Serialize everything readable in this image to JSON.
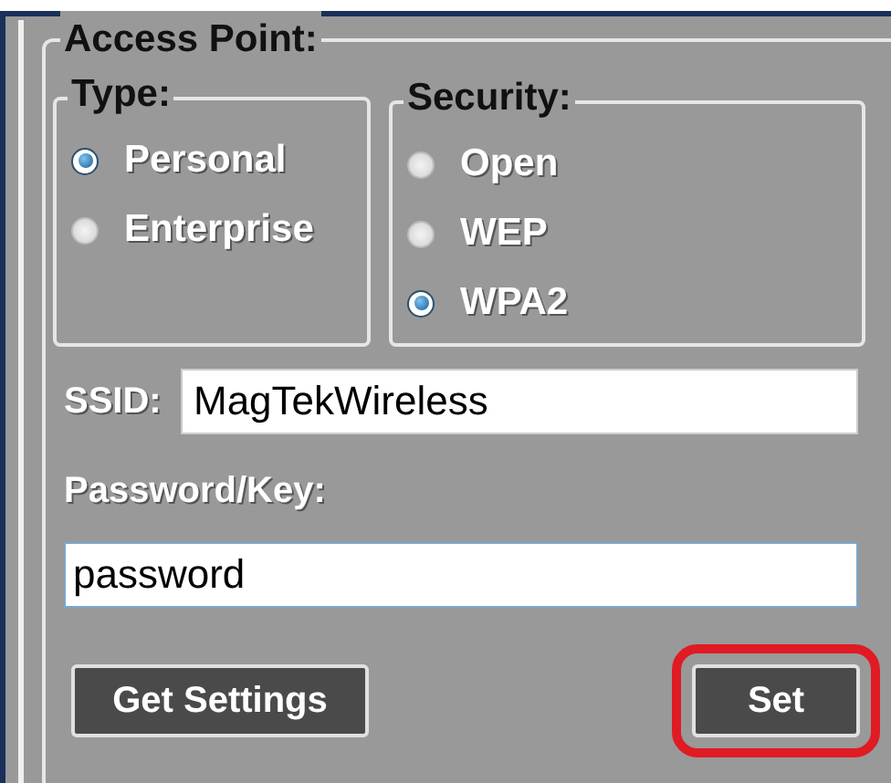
{
  "group": {
    "title": "Access Point:"
  },
  "type_group": {
    "title": "Type:",
    "options": [
      {
        "label": "Personal",
        "selected": true
      },
      {
        "label": "Enterprise",
        "selected": false
      }
    ]
  },
  "security_group": {
    "title": "Security:",
    "options": [
      {
        "label": "Open",
        "selected": false
      },
      {
        "label": "WEP",
        "selected": false
      },
      {
        "label": "WPA2",
        "selected": true
      }
    ]
  },
  "ssid": {
    "label": "SSID:",
    "value": "MagTekWireless"
  },
  "password": {
    "label": "Password/Key:",
    "value": "password"
  },
  "buttons": [
    {
      "label": "Get Settings",
      "highlighted": false
    },
    {
      "label": "Set",
      "highlighted": true
    }
  ]
}
